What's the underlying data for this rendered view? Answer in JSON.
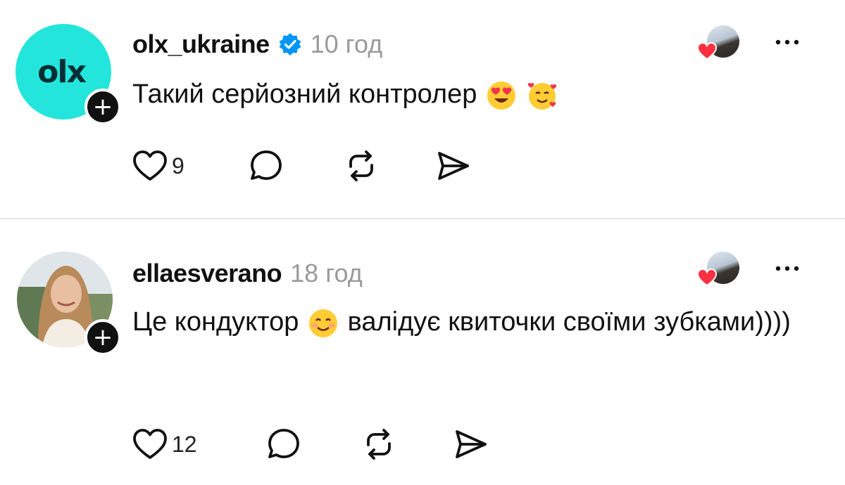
{
  "posts": [
    {
      "username": "olx_ukraine",
      "verified": true,
      "time": "10 год",
      "text_before": "Такий серйозний контролер",
      "text_after": "",
      "likes": "9",
      "avatar_logo": "olx",
      "colors": {
        "avatar_bg": "#23e5db",
        "logo": "#002f34"
      }
    },
    {
      "username": "ellaesverano",
      "verified": false,
      "time": "18 год",
      "text_before": "Це кондуктор",
      "text_after": "валідує квиточки своїми зубками))))",
      "likes": "12"
    }
  ],
  "icons": {
    "verified": "verified-badge-icon",
    "heart": "heart-icon",
    "comment": "comment-icon",
    "repost": "repost-icon",
    "share": "share-icon",
    "more": "more-icon",
    "follow": "plus-icon"
  },
  "colors": {
    "verified_blue": "#0095f6",
    "heart_red": "#ff3040",
    "muted_text": "#9a9a9a",
    "divider": "#e6e6e6"
  }
}
